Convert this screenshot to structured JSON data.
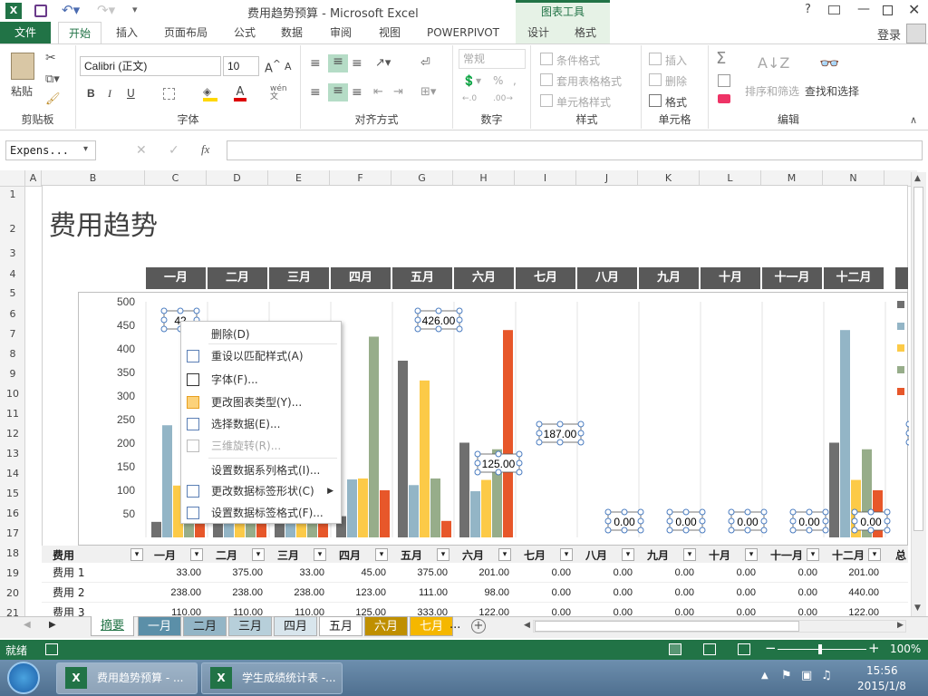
{
  "window": {
    "title": "费用趋势预算 - Microsoft Excel",
    "context_tab_group": "图表工具",
    "help": "?",
    "login": "登录"
  },
  "ribbon_tabs": [
    "文件",
    "开始",
    "插入",
    "页面布局",
    "公式",
    "数据",
    "审阅",
    "视图",
    "POWERPIVOT",
    "设计",
    "格式"
  ],
  "ribbon": {
    "paste": "粘贴",
    "clipboard_label": "剪贴板",
    "font_name": "Calibri (正文)",
    "font_size": "10",
    "font_label": "字体",
    "bold": "B",
    "italic": "I",
    "underline": "U",
    "wen": "wén\n文",
    "align_label": "对齐方式",
    "number_format": "常规",
    "percent": "%",
    "number_label": "数字",
    "cond_format": "条件格式",
    "table_format": "套用表格格式",
    "cell_style": "单元格样式",
    "style_label": "样式",
    "insert": "插入",
    "delete": "删除",
    "format": "格式",
    "cells_label": "单元格",
    "sort_filter": "排序和筛选",
    "find_select": "查找和选择",
    "edit_label": "编辑",
    "sigma": "Σ"
  },
  "formula_bar": {
    "name_box": "Expens...",
    "fx": "fx",
    "value": ""
  },
  "columns": [
    "A",
    "B",
    "C",
    "D",
    "E",
    "F",
    "G",
    "H",
    "I",
    "J",
    "K",
    "L",
    "M",
    "N"
  ],
  "rows": [
    "1",
    "2",
    "3",
    "4",
    "5",
    "6",
    "7",
    "8",
    "9",
    "10",
    "11",
    "12",
    "13",
    "14",
    "15",
    "16",
    "17",
    "18",
    "19",
    "20",
    "21"
  ],
  "sheet": {
    "title": "费用趋势",
    "months": [
      "一月",
      "二月",
      "三月",
      "四月",
      "五月",
      "六月",
      "七月",
      "八月",
      "九月",
      "十月",
      "十一月",
      "十二月"
    ]
  },
  "chart_data": {
    "type": "bar",
    "categories": [
      "一月",
      "二月",
      "三月",
      "四月",
      "五月",
      "六月",
      "七月",
      "八月",
      "九月",
      "十月",
      "十一月",
      "十二月"
    ],
    "series": [
      {
        "values": [
          33,
          375,
          33,
          45,
          375,
          201,
          0,
          0,
          0,
          0,
          0,
          201
        ],
        "color": "#6f6f6f"
      },
      {
        "values": [
          238,
          238,
          238,
          123,
          111,
          98,
          0,
          0,
          0,
          0,
          0,
          440
        ],
        "color": "#93b5c6"
      },
      {
        "values": [
          110,
          110,
          110,
          125,
          333,
          122,
          0,
          0,
          0,
          0,
          0,
          122
        ],
        "color": "#fcca47"
      },
      {
        "values": [
          426,
          426,
          426,
          426,
          125,
          187,
          0,
          0,
          0,
          0,
          0,
          187
        ],
        "color": "#97ad8a"
      },
      {
        "values": [
          30,
          30,
          30,
          100,
          35,
          440,
          0,
          0,
          0,
          0,
          0,
          100
        ],
        "color": "#e7572a"
      }
    ],
    "ylim": [
      0,
      500
    ],
    "yticks": [
      50,
      100,
      150,
      200,
      250,
      300,
      350,
      400,
      450,
      500
    ],
    "labels": [
      {
        "col": 0,
        "text": "42"
      },
      {
        "col": 3,
        "text": "426.00"
      },
      {
        "col": 4,
        "text": "125.00"
      },
      {
        "col": 5,
        "text": "187.00"
      },
      {
        "col": 6,
        "text": "0.00"
      },
      {
        "col": 7,
        "text": "0.00"
      },
      {
        "col": 8,
        "text": "0.00"
      },
      {
        "col": 9,
        "text": "0.00"
      },
      {
        "col": 10,
        "text": "0.00"
      },
      {
        "col": 11,
        "text": "187.00"
      }
    ]
  },
  "table": {
    "header_first": "费用",
    "months": [
      "一月",
      "二月",
      "三月",
      "四月",
      "五月",
      "六月",
      "七月",
      "八月",
      "九月",
      "十月",
      "十一月",
      "十二月"
    ],
    "total_partial": "总",
    "rows": [
      {
        "name": "费用 1",
        "values": [
          "33.00",
          "375.00",
          "33.00",
          "45.00",
          "375.00",
          "201.00",
          "0.00",
          "0.00",
          "0.00",
          "0.00",
          "0.00",
          "201.00"
        ]
      },
      {
        "name": "费用 2",
        "values": [
          "238.00",
          "238.00",
          "238.00",
          "123.00",
          "111.00",
          "98.00",
          "0.00",
          "0.00",
          "0.00",
          "0.00",
          "0.00",
          "440.00"
        ]
      },
      {
        "name": "费用 3",
        "values": [
          "110.00",
          "110.00",
          "110.00",
          "125.00",
          "333.00",
          "122.00",
          "0.00",
          "0.00",
          "0.00",
          "0.00",
          "0.00",
          "122.00"
        ]
      }
    ]
  },
  "context_menu": [
    {
      "label": "删除(D)",
      "icon": "",
      "disabled": false
    },
    {
      "label": "重设以匹配样式(A)",
      "icon": "reset-style-icon",
      "disabled": false
    },
    {
      "label": "字体(F)...",
      "icon": "font-icon",
      "disabled": false
    },
    {
      "label": "更改图表类型(Y)...",
      "icon": "chart-type-icon",
      "disabled": false
    },
    {
      "label": "选择数据(E)...",
      "icon": "select-data-icon",
      "disabled": false
    },
    {
      "label": "三维旋转(R)...",
      "icon": "rotate-3d-icon",
      "disabled": true
    },
    {
      "label": "设置数据系列格式(I)...",
      "icon": "",
      "disabled": false
    },
    {
      "label": "更改数据标签形状(C)",
      "icon": "label-shape-icon",
      "disabled": false
    },
    {
      "label": "设置数据标签格式(F)...",
      "icon": "format-label-icon",
      "disabled": false
    }
  ],
  "sheet_tabs": [
    {
      "label": "摘要",
      "bg": "#ffffff",
      "fg": "#217346"
    },
    {
      "label": "一月",
      "bg": "#5b8fa8",
      "fg": "#ffffff"
    },
    {
      "label": "二月",
      "bg": "#93b5c6",
      "fg": "#222222"
    },
    {
      "label": "三月",
      "bg": "#b7cfda",
      "fg": "#222222"
    },
    {
      "label": "四月",
      "bg": "#d8e5ec",
      "fg": "#222222"
    },
    {
      "label": "五月",
      "bg": "#ffffff",
      "fg": "#222222"
    },
    {
      "label": "六月",
      "bg": "#bf8f00",
      "fg": "#ffffff"
    },
    {
      "label": "七月",
      "bg": "#f5b700",
      "fg": "#ffffff"
    }
  ],
  "more_tabs": "...",
  "status": {
    "ready": "就绪",
    "zoom": "100%"
  },
  "taskbar": {
    "items": [
      "费用趋势预算 - ...",
      "学生成绩统计表 -..."
    ],
    "time": "15:56",
    "date": "2015/1/8"
  }
}
